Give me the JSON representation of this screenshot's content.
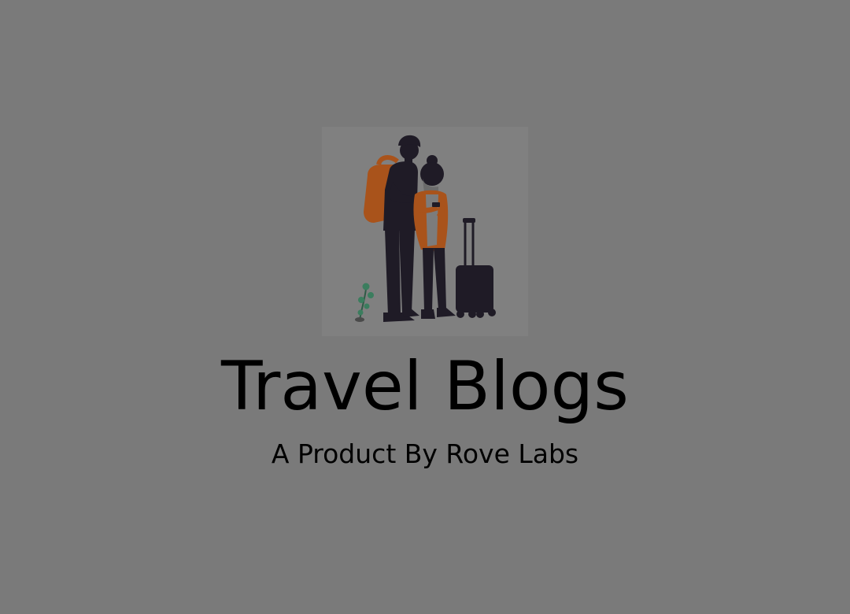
{
  "app": {
    "title": "Travel Blogs",
    "subtitle": "A Product By Rove Labs"
  },
  "illustration": {
    "icon": "travelers-with-luggage-illustration"
  },
  "colors": {
    "background": "#7a7a7a",
    "illustration_background": "#808080",
    "text": "#000000",
    "accent_orange": "#a9531b",
    "figure_dark": "#1f1b26",
    "plant_green": "#3b7d5e"
  }
}
